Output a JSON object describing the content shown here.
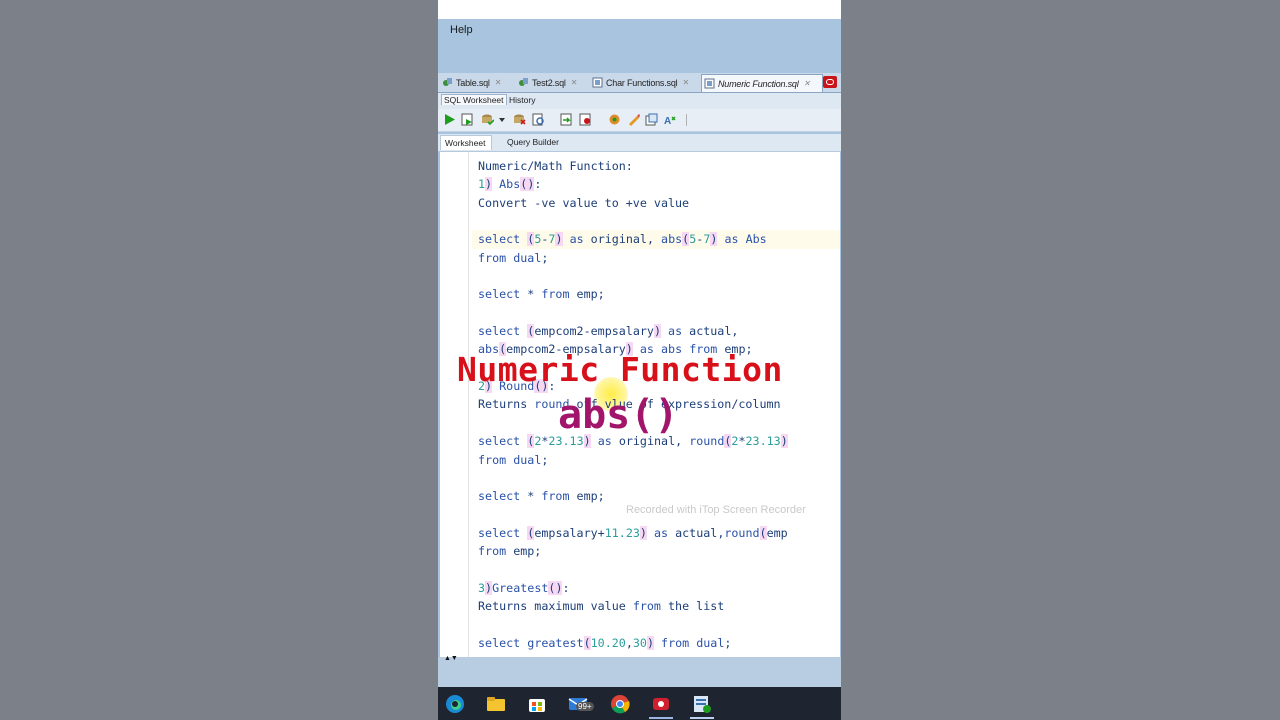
{
  "menubar": {
    "help": "Help"
  },
  "doc_tabs": [
    {
      "label": "Table.sql",
      "icon": "sql-file-icon"
    },
    {
      "label": "Test2.sql",
      "icon": "sql-file-icon"
    },
    {
      "label": "Char Functions.sql",
      "icon": "sql-file-icon"
    },
    {
      "label": "Numeric Function.sql",
      "icon": "sql-file-icon",
      "active": true
    }
  ],
  "sub_tabs": {
    "worksheet": "SQL Worksheet",
    "history": "History"
  },
  "toolbar_icons": [
    "run-statement-icon",
    "run-script-icon",
    "commit-icon",
    "dropdown-icon",
    "rollback-icon",
    "explain-plan-icon",
    "autotrace-icon",
    "sql-tuning-icon",
    "clear-icon",
    "format-icon",
    "to-upper-icon",
    "find-icon"
  ],
  "editor_tabs": {
    "worksheet": "Worksheet",
    "query_builder": "Query Builder"
  },
  "code_lines": [
    "Numeric/Math Function:",
    "1) Abs():",
    "Convert -ve value to +ve value",
    "",
    "select (5-7) as original, abs(5-7) as Abs",
    "from dual;",
    "",
    "select * from emp;",
    "",
    "select (empcom2-empsalary) as actual,",
    "abs(empcom2-empsalary) as abs from emp;",
    "",
    "2) Round():",
    "Returns round off vlue of expression/column",
    "",
    "select (2*23.13) as original, round(2*23.13)",
    "from dual;",
    "",
    "select * from emp;",
    "",
    "select (empsalary+11.23) as actual,round(emp",
    "from emp;",
    "",
    "3)Greatest():",
    "Returns maximum value from the list",
    "",
    "select greatest(10.20,30) from dual;"
  ],
  "watermark": "Recorded with iTop Screen Recorder",
  "overlay": {
    "title": "Numeric Function",
    "subtitle": "abs()"
  },
  "taskbar": {
    "icons": [
      "edge-icon",
      "file-explorer-icon",
      "store-icon",
      "mail-icon",
      "chrome-icon",
      "screen-recorder-icon",
      "sql-developer-icon"
    ],
    "mail_badge": "99+"
  },
  "colors": {
    "keyword": "#2a52a8",
    "number": "#2c9c9c",
    "overlay_title": "#d7101a",
    "overlay_subtitle": "#a1156a"
  }
}
